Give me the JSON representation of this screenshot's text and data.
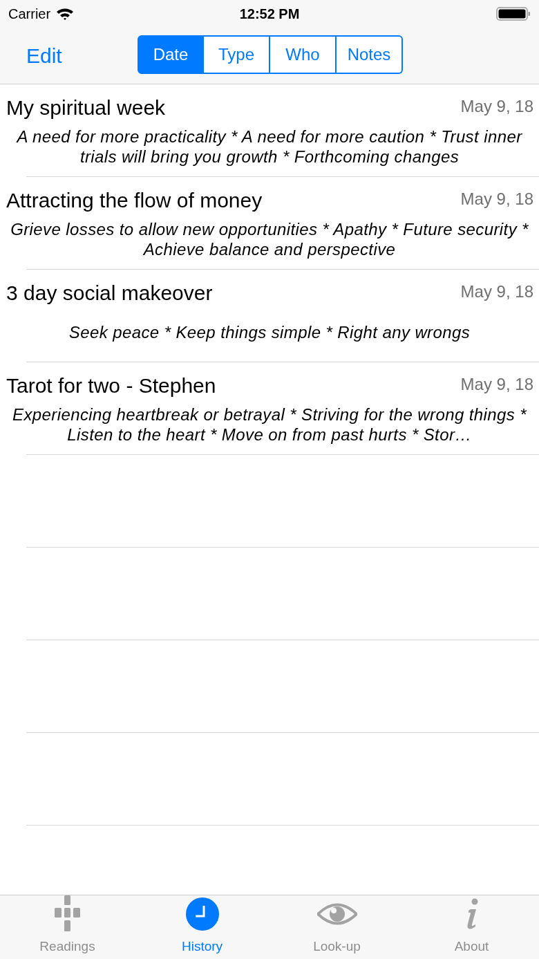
{
  "status_bar": {
    "carrier": "Carrier",
    "time": "12:52 PM"
  },
  "nav": {
    "edit": "Edit",
    "segments": [
      {
        "label": "Date",
        "selected": true
      },
      {
        "label": "Type",
        "selected": false
      },
      {
        "label": "Who",
        "selected": false
      },
      {
        "label": "Notes",
        "selected": false
      }
    ]
  },
  "readings": [
    {
      "title": "My spiritual week",
      "date": "May 9, 18",
      "summary": "A need for more practicality * A need for more caution * Trust inner trials will bring you growth * Forthcoming changes"
    },
    {
      "title": "Attracting the flow of money",
      "date": "May 9, 18",
      "summary": "Grieve losses to allow new opportunities * Apathy * Future security * Achieve balance and perspective"
    },
    {
      "title": "3 day social makeover",
      "date": "May 9, 18",
      "summary": "Seek peace * Keep things simple * Right any wrongs"
    },
    {
      "title": "Tarot for two - Stephen",
      "date": "May 9, 18",
      "summary": "Experiencing heartbreak or betrayal * Striving for the wrong things * Listen to the heart * Move on from past hurts * Stor…"
    }
  ],
  "tab_bar": [
    {
      "kind": "readings",
      "label": "Readings",
      "selected": false
    },
    {
      "kind": "history",
      "label": "History",
      "selected": true
    },
    {
      "kind": "lookup",
      "label": "Look-up",
      "selected": false
    },
    {
      "kind": "about",
      "label": "About",
      "selected": false
    }
  ]
}
